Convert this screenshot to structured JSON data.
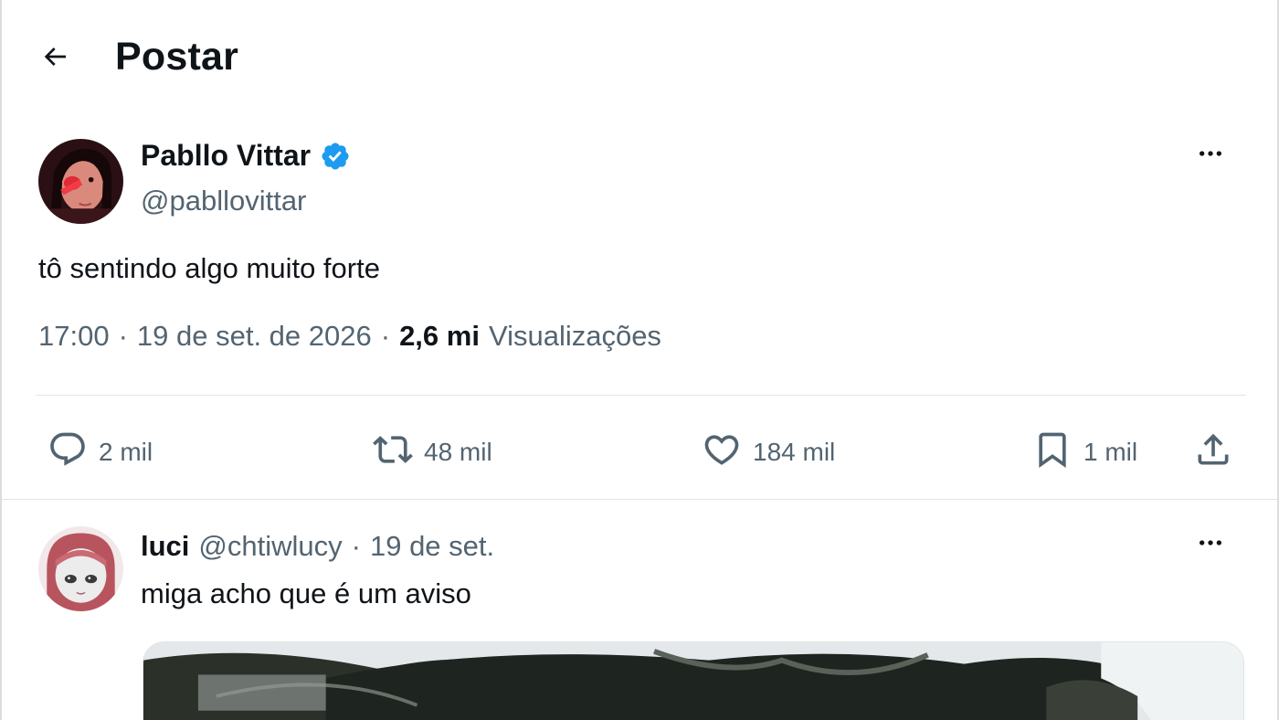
{
  "header": {
    "title": "Postar",
    "back_icon": "arrow-left-icon"
  },
  "post": {
    "author": {
      "name": "Pabllo Vittar",
      "handle": "@pabllovittar",
      "verified": true,
      "verified_color": "#1d9bf0"
    },
    "text": "tô sentindo algo muito forte",
    "time": "17:00",
    "date": "19 de set. de 2026",
    "views_count": "2,6 mi",
    "views_label": "Visualizações",
    "separator": "·",
    "actions": {
      "replies": {
        "icon": "reply-icon",
        "count": "2 mil"
      },
      "reposts": {
        "icon": "repost-icon",
        "count": "48 mil"
      },
      "likes": {
        "icon": "heart-icon",
        "count": "184 mil"
      },
      "bookmarks": {
        "icon": "bookmark-icon",
        "count": "1 mil"
      },
      "share": {
        "icon": "share-icon"
      }
    }
  },
  "reply": {
    "author": {
      "name": "luci",
      "handle": "@chtiwlucy"
    },
    "separator": "·",
    "date": "19 de set.",
    "text": "miga acho que é um aviso"
  },
  "colors": {
    "text_primary": "#0f1419",
    "text_secondary": "#536471",
    "divider": "#e1e4e8",
    "accent": "#1d9bf0"
  }
}
